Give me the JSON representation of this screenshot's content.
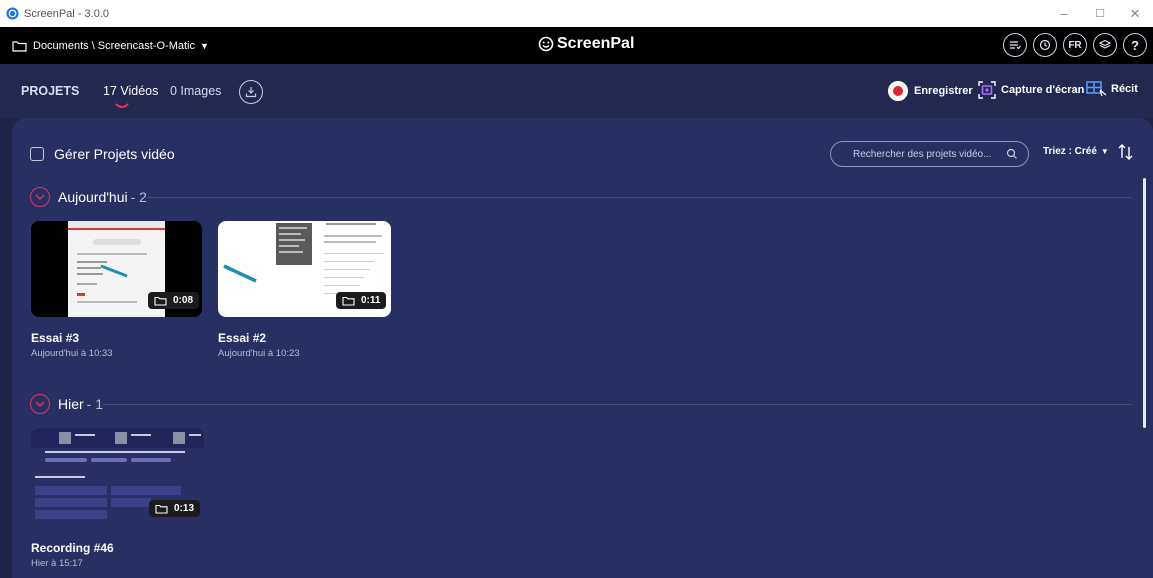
{
  "window": {
    "title": "ScreenPal - 3.0.0",
    "controls": {
      "minimize": "–",
      "maximize": "☐",
      "close": "✕"
    }
  },
  "topbar": {
    "folder_path": "Documents \\ Screencast-O-Matic",
    "logo_text": "ScreenPal",
    "icons": [
      "queue-icon",
      "history-icon",
      "language-fr",
      "layers-icon",
      "help-icon"
    ],
    "language": "FR",
    "help": "?"
  },
  "nav": {
    "tabs": [
      {
        "label": "PROJETS",
        "active": false
      },
      {
        "label": "17 Vidéos",
        "active": true
      },
      {
        "label": "0 Images",
        "active": false
      }
    ],
    "actions": [
      {
        "label": "Enregistrer",
        "icon": "record-icon"
      },
      {
        "label": "Capture d'écran",
        "icon": "screenshot-icon"
      },
      {
        "label": "Récit",
        "icon": "story-icon"
      }
    ]
  },
  "toolbar": {
    "manage_label": "Gérer Projets vidéo",
    "search_placeholder": "Rechercher des projets vidéo...",
    "sort_label": "Triez : Créé"
  },
  "sections": [
    {
      "label": "Aujourd'hui",
      "count": "- 2",
      "videos": [
        {
          "title": "Essai #3",
          "date": "Aujourd'hui à 10:33",
          "duration": "0:08"
        },
        {
          "title": "Essai  #2",
          "date": "Aujourd'hui à 10:23",
          "duration": "0:11"
        }
      ]
    },
    {
      "label": "Hier",
      "count": "- 1",
      "videos": [
        {
          "title": "Recording #46",
          "date": "Hier à 15:17",
          "duration": "0:13"
        }
      ]
    }
  ],
  "colors": {
    "background": "#1f2446",
    "panel": "#283063",
    "accent": "#e4355a",
    "record": "#e0262e",
    "screenshot": "#a970ff",
    "story": "#4fa3ff"
  }
}
